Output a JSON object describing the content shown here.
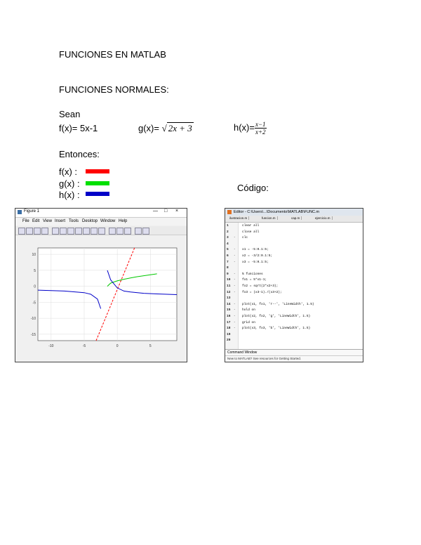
{
  "heading": "FUNCIONES EN MATLAB",
  "subheading": "FUNCIONES NORMALES:",
  "intro": "Sean",
  "functions": {
    "f": {
      "label": "f(x)= 5x-1"
    },
    "g": {
      "prefix": "g(x)= ",
      "sqrt_sign": "√",
      "radicand": "2x + 3"
    },
    "h": {
      "prefix": "h(x)=",
      "numerator": "x−1",
      "denominator": "x+2"
    }
  },
  "then_label": "Entonces:",
  "legend": [
    {
      "label": "f(x) :",
      "color": "#ff0000"
    },
    {
      "label": "g(x) :",
      "color": "#00e000"
    },
    {
      "label": "h(x) :",
      "color": "#0000c8"
    }
  ],
  "code_label": "Código:",
  "figure_window": {
    "title": "Figure 1",
    "menu": [
      "File",
      "Edit",
      "View",
      "Insert",
      "Tools",
      "Desktop",
      "Window",
      "Help"
    ],
    "window_controls": [
      "—",
      "□",
      "×"
    ]
  },
  "chart_data": {
    "type": "line",
    "xlim": [
      -12,
      9
    ],
    "ylim": [
      -17,
      12
    ],
    "xticks": [
      "-10",
      "-5",
      "0",
      "5"
    ],
    "yticks": [
      "10",
      "5",
      "0",
      "-5",
      "-10",
      "-15"
    ],
    "grid": true,
    "series": [
      {
        "color": "#ff0000",
        "style": "dashed",
        "x": [
          -3.2,
          2.6
        ],
        "y": [
          -17,
          12
        ]
      },
      {
        "color": "#00c800",
        "style": "solid",
        "x": [
          -1.5,
          -1,
          0,
          1,
          2,
          3,
          4,
          5,
          6
        ],
        "y": [
          0,
          1,
          1.7,
          2.2,
          2.6,
          3.0,
          3.3,
          3.6,
          3.9
        ]
      },
      {
        "color": "#0000c8",
        "style": "solid",
        "x": [
          -12,
          -8,
          -5,
          -4,
          -3,
          -2.5
        ],
        "y": [
          -1.2,
          -1.5,
          -2,
          -2.5,
          -4,
          -7
        ]
      },
      {
        "color": "#0000c8",
        "style": "solid",
        "x": [
          -1.5,
          -1,
          0,
          1,
          2,
          4,
          6,
          9
        ],
        "y": [
          5,
          2,
          -0.5,
          -1.5,
          -1.8,
          -2.2,
          -2.4,
          -2.6
        ]
      }
    ]
  },
  "editor_window": {
    "title": "Editor - C:\\Users\\...\\Documents\\MATLAB\\FUNC.m",
    "tabs": [
      "ilustracion.m",
      "funcion.m",
      "cap.m",
      "ejercicio.m"
    ],
    "lines": [
      {
        "n": "1",
        "m": "",
        "code": "clear all"
      },
      {
        "n": "2",
        "m": "",
        "code": "close all"
      },
      {
        "n": "3",
        "m": "-",
        "code": "clc"
      },
      {
        "n": "4",
        "m": "",
        "code": ""
      },
      {
        "n": "5",
        "m": "-",
        "code": "x1 = -5:0.1:5;"
      },
      {
        "n": "6",
        "m": "-",
        "code": "x2 = -3/2:0.1:5;"
      },
      {
        "n": "7",
        "m": "-",
        "code": "x3 = -5:0.1:5;"
      },
      {
        "n": "8",
        "m": "",
        "code": ""
      },
      {
        "n": "9",
        "m": "-",
        "code": "% funciones"
      },
      {
        "n": "10",
        "m": "-",
        "code": "fx1 = 5*x1-1;"
      },
      {
        "n": "11",
        "m": "-",
        "code": "fx2 = sqrt(2*x2+3);"
      },
      {
        "n": "12",
        "m": "-",
        "code": "fx3 = (x3-1)./(x3+2);"
      },
      {
        "n": "13",
        "m": "",
        "code": ""
      },
      {
        "n": "14",
        "m": "-",
        "code": "plot(x1, fx1, 'r--', 'LineWidth', 1.5)"
      },
      {
        "n": "15",
        "m": "-",
        "code": "hold on"
      },
      {
        "n": "16",
        "m": "-",
        "code": "plot(x2, fx2, 'g', 'LineWidth', 1.5)"
      },
      {
        "n": "17",
        "m": "-",
        "code": "grid on"
      },
      {
        "n": "18",
        "m": "-",
        "code": "plot(x3, fx3, 'b', 'LineWidth', 1.5)"
      },
      {
        "n": "19",
        "m": "",
        "code": ""
      },
      {
        "n": "20",
        "m": "",
        "code": ""
      }
    ],
    "command_window_label": "Command Window",
    "command_window_text": "New to MATLAB? See resources for Getting Started."
  }
}
